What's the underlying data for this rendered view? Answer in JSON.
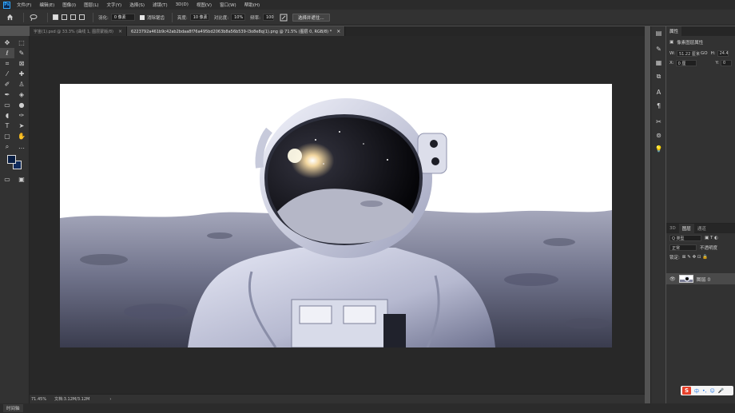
{
  "app": {
    "logo": "Ps"
  },
  "menu": [
    "文件(F)",
    "编辑(E)",
    "图像(I)",
    "图层(L)",
    "文字(Y)",
    "选择(S)",
    "滤镜(T)",
    "3D(D)",
    "视图(V)",
    "窗口(W)",
    "帮助(H)"
  ],
  "options": {
    "feather_label": "羽化:",
    "feather_value": "0 像素",
    "antialias_label": "消除锯齿",
    "style_label": "亮度:",
    "style_value": "10 像素",
    "contrast_label": "对比度:",
    "contrast_value": "10%",
    "frequency_label": "频率:",
    "frequency_value": "100",
    "select_mask_button": "选择并遮住..."
  },
  "tabs": [
    {
      "label": "宇宙(1).psd @ 33.3% (曲线 1, 图层蒙版/8)",
      "active": false
    },
    {
      "label": "6223792a461b9c42ab2bdaa8f76a495bd2063b8a56b539-l3o8e8q(1).png @ 71.5% (图层 0, RGB/8) *",
      "active": true
    }
  ],
  "status": {
    "zoom": "71.45%",
    "doc": "文档:3.12M/3.12M",
    "arrow": "›"
  },
  "timeline": "时间轴",
  "properties": {
    "tab": "属性",
    "section": "像素图层属性",
    "w_label": "W:",
    "w_value": "51.22 厘米",
    "link_label": "GO",
    "h_label": "H:",
    "h_value": "24.4",
    "x_label": "X:",
    "x_value": "0 厘",
    "y_label": "Y:",
    "y_value": "0"
  },
  "layers": {
    "tabs": [
      "3D",
      "图层",
      "通道"
    ],
    "filter": "Q 类型",
    "blend": "正常",
    "opacity": "不透明度",
    "lock_label": "锁定:",
    "layer_name": "图层 0"
  },
  "ime": {
    "logo": "S",
    "lang": "中",
    "items": [
      "•,",
      "☺",
      "🎤"
    ]
  }
}
